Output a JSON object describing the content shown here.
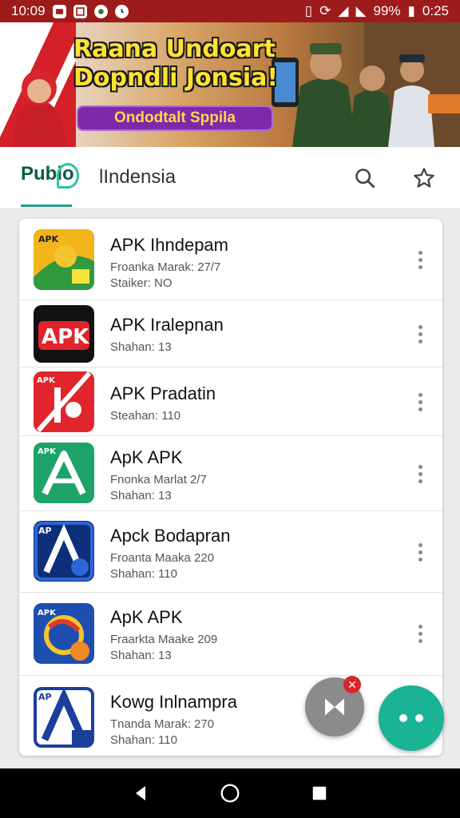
{
  "status_bar": {
    "time": "10:09",
    "battery": "99%",
    "clock_right": "0:25",
    "icons": [
      "image-icon",
      "notification-icon",
      "app-icon",
      "clock-icon",
      "vibrate-icon",
      "data-saver-icon",
      "wifi-icon",
      "signal-icon",
      "battery-icon"
    ]
  },
  "banner": {
    "title_line1": "Raana Undoart",
    "title_line2": "Dopndli Jonsia!",
    "button_label": "Ondodtalt Sppila"
  },
  "header": {
    "logo_text": "Pubio",
    "title": "lIndensia",
    "icons": [
      "search-icon",
      "star-icon"
    ],
    "accent": "#1aa089"
  },
  "apps": [
    {
      "title": "APK Ihndepam",
      "line1": "Froanka Marak: 27/7",
      "line2": "Staiker: NO",
      "icon": "apk-yellow-green-icon",
      "icon_label": "APK"
    },
    {
      "title": "APK Iralepnan",
      "line1": "Shahan: 13",
      "line2": "",
      "icon": "apk-black-red-icon",
      "icon_label": "APK"
    },
    {
      "title": "APK Pradatin",
      "line1": "Steahan: 110",
      "line2": "",
      "icon": "apk-red-diagonal-icon",
      "icon_label": "APK"
    },
    {
      "title": "ApK APK",
      "line1": "Fnonka Marlat 2/7",
      "line2": "Shahan: 13",
      "icon": "apk-green-a-icon",
      "icon_label": "APK"
    },
    {
      "title": "Apck Bodapran",
      "line1": "Froanta Maaka 220",
      "line2": "Shahan: 110",
      "icon": "apk-blue-a-icon",
      "icon_label": "AP"
    },
    {
      "title": "ApK APK",
      "line1": "Fraarkta Maake 209",
      "line2": "Shahan: 13",
      "icon": "apk-blue-swirl-icon",
      "icon_label": "APK"
    },
    {
      "title": "Kowg Inlnampra",
      "line1": "Tnanda Marak: 270",
      "line2": "Shahan: 110",
      "icon": "apk-white-a-icon",
      "icon_label": "AP"
    }
  ],
  "colors": {
    "status_bar": "#9e1b1b",
    "fab_green": "#1ab393",
    "fab_gray": "#8b8b8b"
  },
  "nav": [
    "back-icon",
    "home-icon",
    "recents-icon"
  ]
}
